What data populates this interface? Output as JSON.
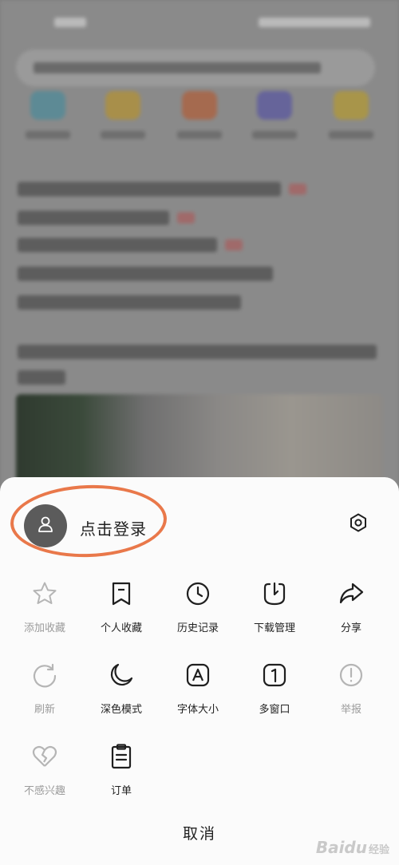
{
  "sheet": {
    "login_label": "点击登录",
    "cancel_label": "取消"
  },
  "menu": [
    {
      "label": "添加收藏",
      "icon": "star-icon",
      "disabled": true
    },
    {
      "label": "个人收藏",
      "icon": "bookmark-icon",
      "disabled": false
    },
    {
      "label": "历史记录",
      "icon": "clock-icon",
      "disabled": false
    },
    {
      "label": "下载管理",
      "icon": "download-icon",
      "disabled": false
    },
    {
      "label": "分享",
      "icon": "share-icon",
      "disabled": false
    },
    {
      "label": "刷新",
      "icon": "refresh-icon",
      "disabled": true
    },
    {
      "label": "深色模式",
      "icon": "moon-icon",
      "disabled": false
    },
    {
      "label": "字体大小",
      "icon": "font-size-icon",
      "disabled": false
    },
    {
      "label": "多窗口",
      "icon": "multi-window-icon",
      "disabled": false
    },
    {
      "label": "举报",
      "icon": "report-icon",
      "disabled": true
    },
    {
      "label": "不感兴趣",
      "icon": "broken-heart-icon",
      "disabled": true
    },
    {
      "label": "订单",
      "icon": "order-icon",
      "disabled": false
    }
  ],
  "colors": {
    "highlight": "#e9784a",
    "icon_active": "#1f1f1f",
    "icon_disabled": "#b5b5b5"
  },
  "watermark": {
    "brand": "Baidu",
    "sub": "经验"
  }
}
